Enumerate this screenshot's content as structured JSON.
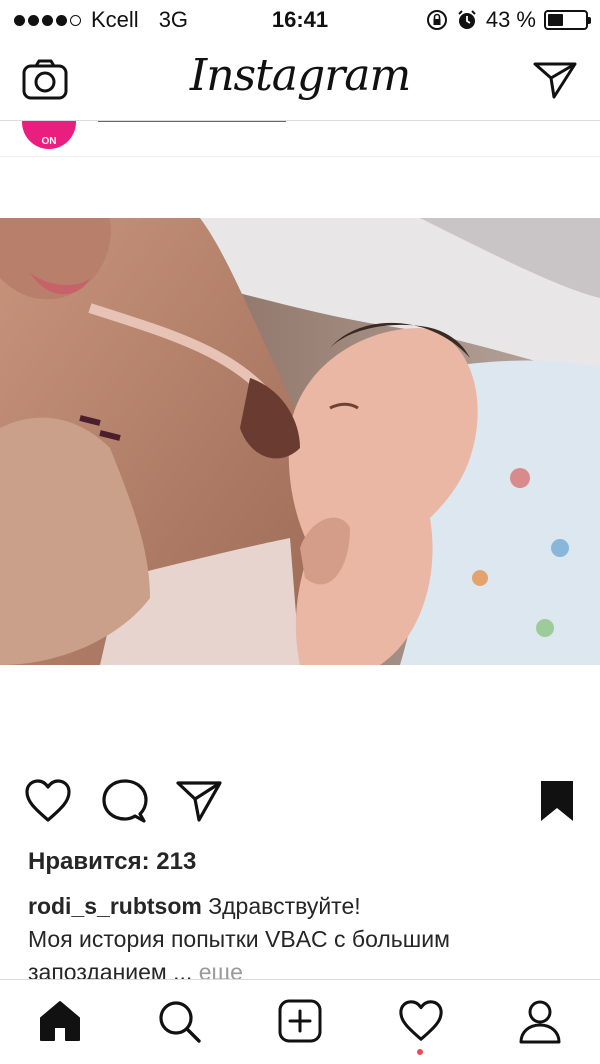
{
  "status_bar": {
    "carrier": "Kcell",
    "network": "3G",
    "time": "16:41",
    "battery_percent": "43 %",
    "battery_level": 0.43,
    "signal_bars_filled": 4,
    "signal_bars_total": 5
  },
  "navbar": {
    "title": "Instagram",
    "left_icon": "camera-icon",
    "right_icon": "direct-message-icon"
  },
  "previous_post": {
    "avatar_text": "ON"
  },
  "post": {
    "actions": [
      "heart-icon",
      "comment-icon",
      "share-icon",
      "bookmark-icon"
    ],
    "likes_text": "Нравится: 213",
    "username": "rodi_s_rubtsom",
    "caption_first": "Здравствуйте!",
    "caption_rest": "Моя история попытки VBAC с большим запозданием ...",
    "more_label": "еще"
  },
  "tab_bar": {
    "items": [
      "home-icon",
      "search-icon",
      "add-post-icon",
      "activity-heart-icon",
      "profile-icon"
    ],
    "accent_color": "#ed4956"
  }
}
